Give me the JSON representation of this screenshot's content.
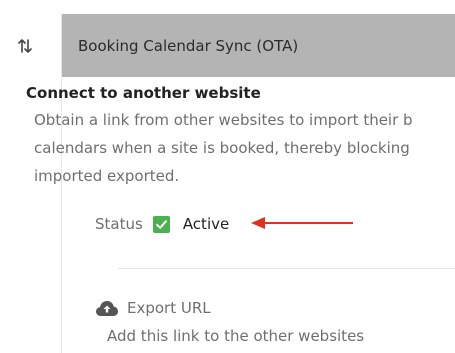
{
  "panel": {
    "header_title": "Booking Calendar Sync (OTA)",
    "section_title": "Connect to another website",
    "description_lines": [
      "Obtain a link from other websites to import their b",
      "calendars when a site is booked, thereby blocking",
      "imported exported."
    ],
    "status": {
      "label": "Status",
      "value": "Active",
      "checked": true,
      "checkbox_color": "#4caf50",
      "arrow_color": "#e0301e"
    },
    "export": {
      "title": "Export URL",
      "description": "Add this link to the other websites"
    }
  },
  "colors": {
    "header_bg": "#b4b4b4",
    "text_muted": "#6f6f6f",
    "text_dark": "#222222"
  },
  "icons": {
    "sort": "sort-arrows-icon",
    "checkbox": "checkmark-icon",
    "export": "cloud-upload-icon"
  }
}
